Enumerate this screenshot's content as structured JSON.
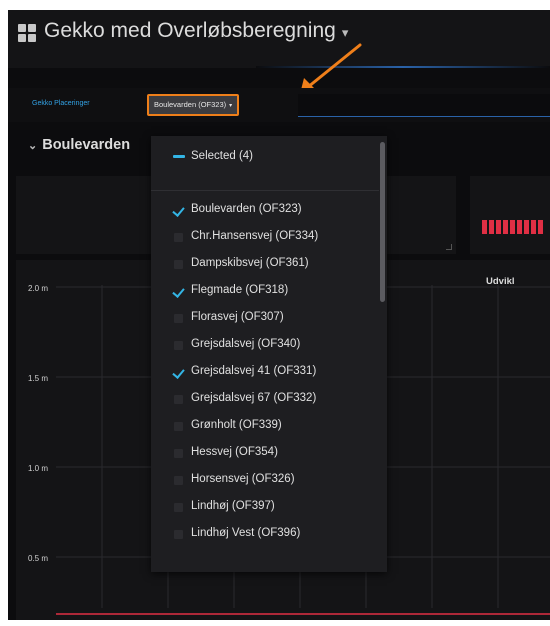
{
  "dashboard": {
    "title": "Gekko med Overløbsberegning",
    "title_caret": "▾"
  },
  "variable_bar": {
    "label": "Gekko Placeringer",
    "selected_value": "Boulevarden (OF323)",
    "caret": "▾"
  },
  "row": {
    "chevron": "⌄",
    "title": "Boulevarden"
  },
  "chart": {
    "title": "Udvikl",
    "y_ticks": [
      "2.0 m",
      "1.5 m",
      "1.0 m",
      "0.5 m"
    ]
  },
  "dropdown": {
    "selected_summary": "Selected (4)",
    "options": [
      {
        "label": "Boulevarden (OF323)",
        "checked": true
      },
      {
        "label": "Chr.Hansensvej (OF334)",
        "checked": false
      },
      {
        "label": "Dampskibsvej (OF361)",
        "checked": false
      },
      {
        "label": "Flegmade (OF318)",
        "checked": true
      },
      {
        "label": "Florasvej (OF307)",
        "checked": false
      },
      {
        "label": "Grejsdalsvej (OF340)",
        "checked": false
      },
      {
        "label": "Grejsdalsvej 41 (OF331)",
        "checked": true
      },
      {
        "label": "Grejsdalsvej 67 (OF332)",
        "checked": false
      },
      {
        "label": "Grønholt (OF339)",
        "checked": false
      },
      {
        "label": "Hessvej (OF354)",
        "checked": false
      },
      {
        "label": "Horsensvej (OF326)",
        "checked": false
      },
      {
        "label": "Lindhøj (OF397)",
        "checked": false
      },
      {
        "label": "Lindhøj Vest (OF396)",
        "checked": false
      }
    ]
  },
  "colors": {
    "accent_blue": "#33b5e5",
    "highlight_orange": "#ef7f1a",
    "alert_red": "#e02f44",
    "background": "#0c0c0e"
  }
}
